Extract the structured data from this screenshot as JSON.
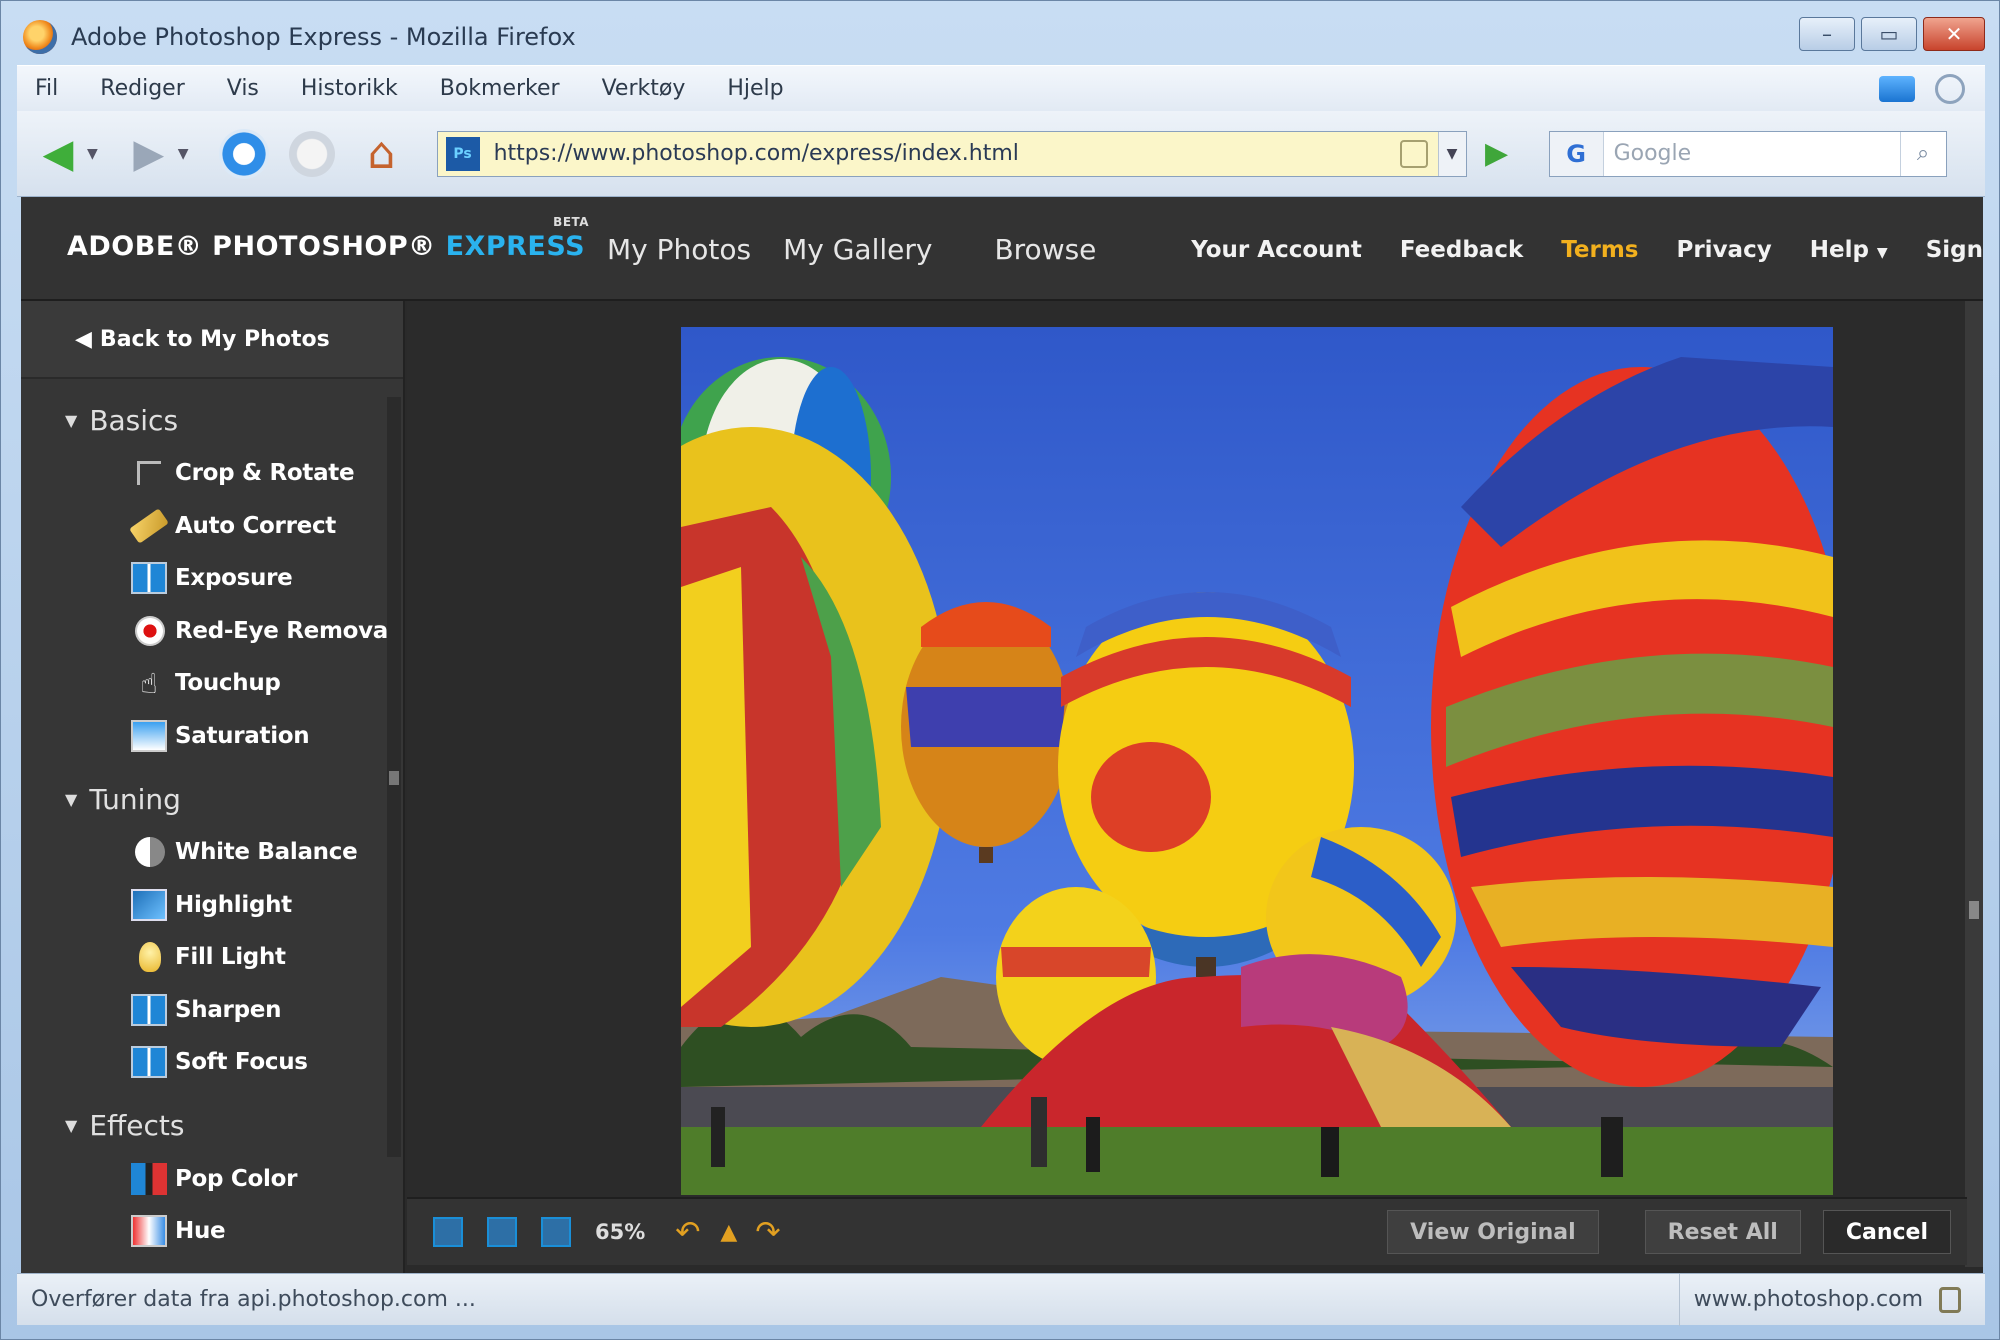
{
  "window": {
    "title": "Adobe Photoshop Express - Mozilla Firefox",
    "controls": {
      "minimize": "–",
      "maximize": "▭",
      "close": "✕"
    }
  },
  "menubar": {
    "items": [
      "Fil",
      "Rediger",
      "Vis",
      "Historikk",
      "Bokmerker",
      "Verktøy",
      "Hjelp"
    ]
  },
  "navbar": {
    "url": "https://www.photoshop.com/express/index.html",
    "favicon": "Ps",
    "search_engine": "G",
    "search_placeholder": "Google",
    "icons": [
      "back-arrow-icon",
      "forward-arrow-icon",
      "reload-icon",
      "stop-icon",
      "home-icon",
      "go-icon",
      "search-icon"
    ]
  },
  "app": {
    "logo": {
      "main": "ADOBE® PHOTOSHOP®",
      "express": "EXPRESS",
      "beta": "BETA"
    },
    "topnav": [
      "My Photos",
      "My Gallery",
      "Browse"
    ],
    "rightnav": [
      "Your Account",
      "Feedback",
      "Terms",
      "Privacy",
      "Help",
      "Sign"
    ],
    "active_rightnav": "Terms",
    "accent_color": "#f2b01e",
    "express_color": "#2ab3ef"
  },
  "sidebar": {
    "back_label": "Back to My Photos",
    "sections": [
      {
        "label": "Basics",
        "tools": [
          "Crop & Rotate",
          "Auto Correct",
          "Exposure",
          "Red-Eye Removal",
          "Touchup",
          "Saturation"
        ]
      },
      {
        "label": "Tuning",
        "tools": [
          "White Balance",
          "Highlight",
          "Fill Light",
          "Sharpen",
          "Soft Focus"
        ]
      },
      {
        "label": "Effects",
        "tools": [
          "Pop Color",
          "Hue"
        ]
      }
    ]
  },
  "bottombar": {
    "zoom": "65%",
    "view_original": "View Original",
    "reset_all": "Reset All",
    "cancel": "Cancel"
  },
  "statusbar": {
    "left": "Overfører data fra api.photoshop.com ...",
    "right": "www.photoshop.com"
  }
}
